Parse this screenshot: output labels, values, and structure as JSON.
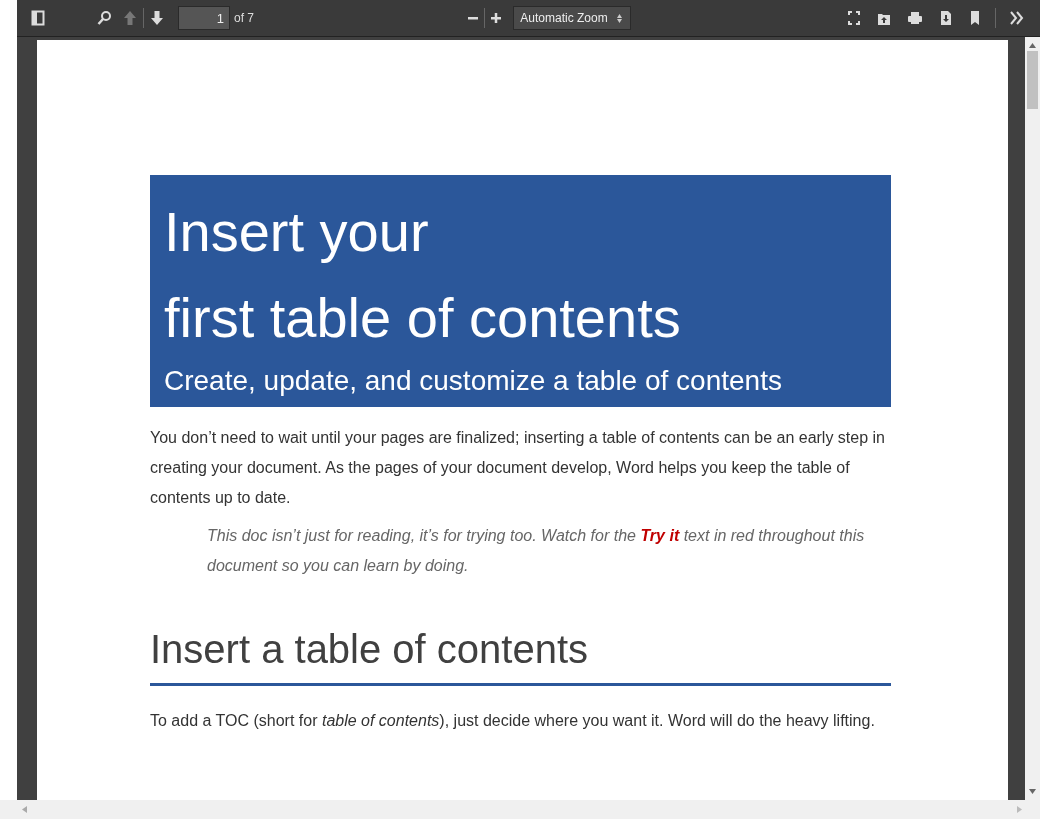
{
  "toolbar": {
    "buttons": [
      {
        "kind": "sidebar",
        "disabled": false
      },
      {
        "kind": "find",
        "disabled": false
      },
      {
        "kind": "previous",
        "disabled": true
      },
      {
        "kind": "next",
        "disabled": false
      }
    ],
    "page_number": "1",
    "page_count": "of 7",
    "zoom_select": "Automatic Zoom",
    "right_buttons": [
      {
        "kind": "fullscreen"
      },
      {
        "kind": "open"
      },
      {
        "kind": "print"
      },
      {
        "kind": "download"
      },
      {
        "kind": "bookmark"
      },
      {
        "kind": "tools"
      }
    ]
  },
  "document": {
    "title_lines": [
      "Insert your",
      "first table of contents"
    ],
    "subtitle": "Create, update, and customize a table of contents",
    "intro": "You don’t need to wait until your pages are finalized; inserting a table of contents can be an early step in creating your document. As the pages of your document develop, Word helps you keep the table of contents up to date.",
    "tip": "This doc isn’t just for reading, it’s for trying too. Watch for the **Try it** text in red throughout this document so you can learn by doing.",
    "heading": "Insert a table of contents",
    "paragraph": "To add a TOC (short for *table of contents*), just decide where you want it. Word will do the heavy lifting."
  }
}
